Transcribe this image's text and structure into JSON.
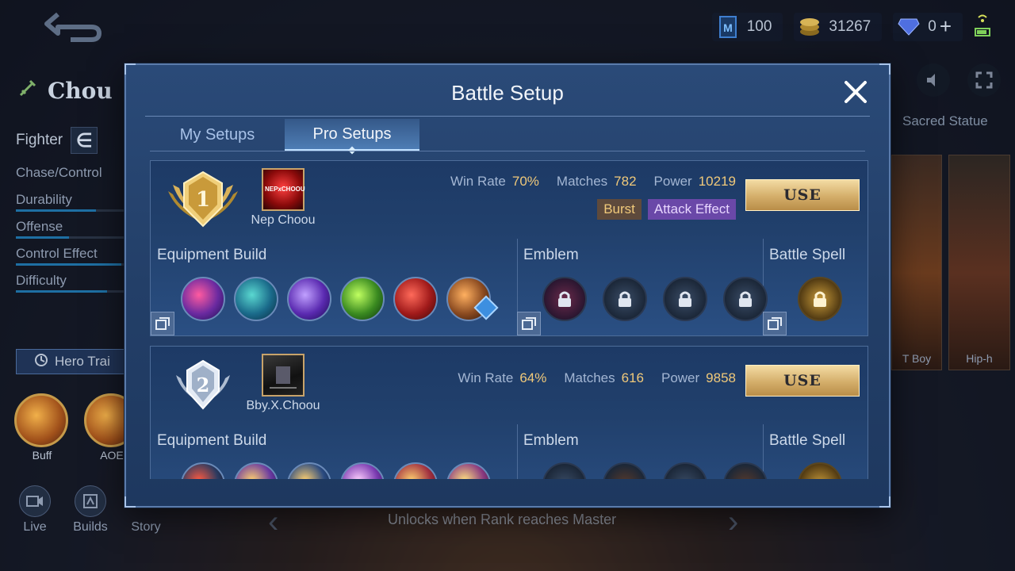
{
  "header": {
    "currencies": [
      {
        "icon": "m-ticket-icon",
        "value": "100"
      },
      {
        "icon": "gold-coin-icon",
        "value": "31267"
      },
      {
        "icon": "diamond-icon",
        "value": "0"
      }
    ],
    "add_label": "+"
  },
  "hero": {
    "name": "Chou",
    "role": "Fighter",
    "tags": "Chase/Control",
    "stats": [
      {
        "label": "Durability",
        "level": 0.72
      },
      {
        "label": "Offense",
        "level": 0.48
      },
      {
        "label": "Control Effect",
        "level": 0.95
      },
      {
        "label": "Difficulty",
        "level": 0.82
      }
    ],
    "train_label": "Hero Trai",
    "skills": [
      "Buff",
      "AOE"
    ]
  },
  "bottom_nav": [
    "Live",
    "Builds",
    "Story"
  ],
  "unlock_text": "Unlocks when Rank reaches Master",
  "side": {
    "sacred_label": "Sacred Statue",
    "skins": [
      "T Boy",
      "Hip-h"
    ]
  },
  "modal": {
    "title": "Battle Setup",
    "tabs": [
      "My Setups",
      "Pro Setups"
    ],
    "active_tab": "Pro Setups",
    "section_labels": {
      "equipment": "Equipment Build",
      "emblem": "Emblem",
      "spell": "Battle Spell"
    },
    "use_label": "USE",
    "stat_labels": {
      "win_rate": "Win Rate",
      "matches": "Matches",
      "power": "Power"
    },
    "setups": [
      {
        "rank": "1",
        "player": "Nep Choou",
        "avatar_text": "NEPxCHOOU",
        "win_rate": "70%",
        "matches": "782",
        "power": "10219",
        "tags": [
          "Burst",
          "Attack Effect"
        ]
      },
      {
        "rank": "2",
        "player": "Bby.X.Choou",
        "avatar_text": "",
        "win_rate": "64%",
        "matches": "616",
        "power": "9858",
        "tags": []
      }
    ]
  },
  "colors": {
    "accent_gold": "#f0c97a",
    "panel_blue": "#233f68",
    "tab_text": "#a8c2e8",
    "attack_tag": "#6a48a8",
    "burst_tag": "#5e4a3c"
  }
}
